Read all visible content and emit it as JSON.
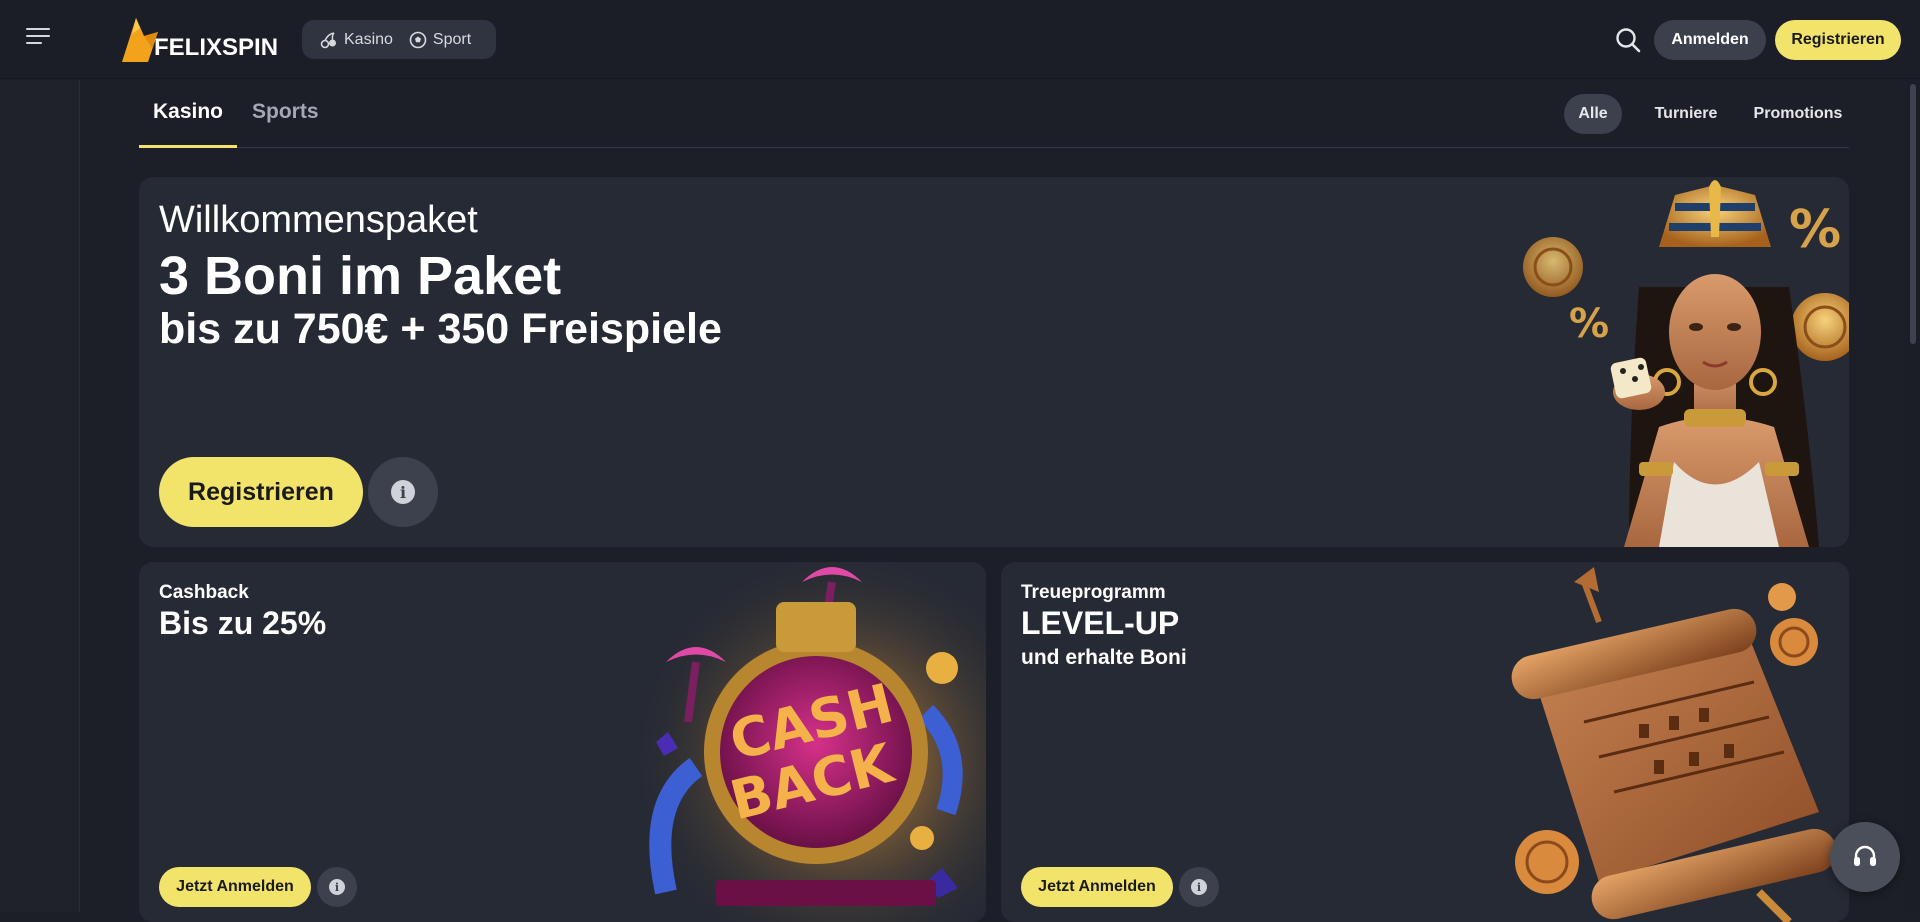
{
  "header": {
    "brand": "FELIXSPIN",
    "nav": [
      {
        "label": "Kasino",
        "icon": "cherries-icon"
      },
      {
        "label": "Sport",
        "icon": "soccer-ball-icon"
      }
    ],
    "login_label": "Anmelden",
    "register_label": "Registrieren"
  },
  "tabs": [
    {
      "label": "Kasino",
      "active": true
    },
    {
      "label": "Sports",
      "active": false
    }
  ],
  "filters": [
    {
      "label": "Alle",
      "active": true
    },
    {
      "label": "Turniere",
      "active": false
    },
    {
      "label": "Promotions",
      "active": false
    }
  ],
  "hero": {
    "eyebrow": "Willkommenspaket",
    "title": "3 Boni im Paket",
    "subtitle": "bis zu 750€ + 350 Freispiele",
    "cta_label": "Registrieren"
  },
  "cards": [
    {
      "eyebrow": "Cashback",
      "title": "Bis zu 25%",
      "subtitle": "",
      "cta_label": "Jetzt Anmelden",
      "art": "cash-back-illustration"
    },
    {
      "eyebrow": "Treueprogramm",
      "title": "LEVEL-UP",
      "subtitle": "und erhalte Boni",
      "cta_label": "Jetzt Anmelden",
      "art": "scroll-illustration"
    }
  ],
  "colors": {
    "background": "#1c1f27",
    "card": "#262a34",
    "accent": "#f2e36b",
    "pill": "#3c414d"
  }
}
